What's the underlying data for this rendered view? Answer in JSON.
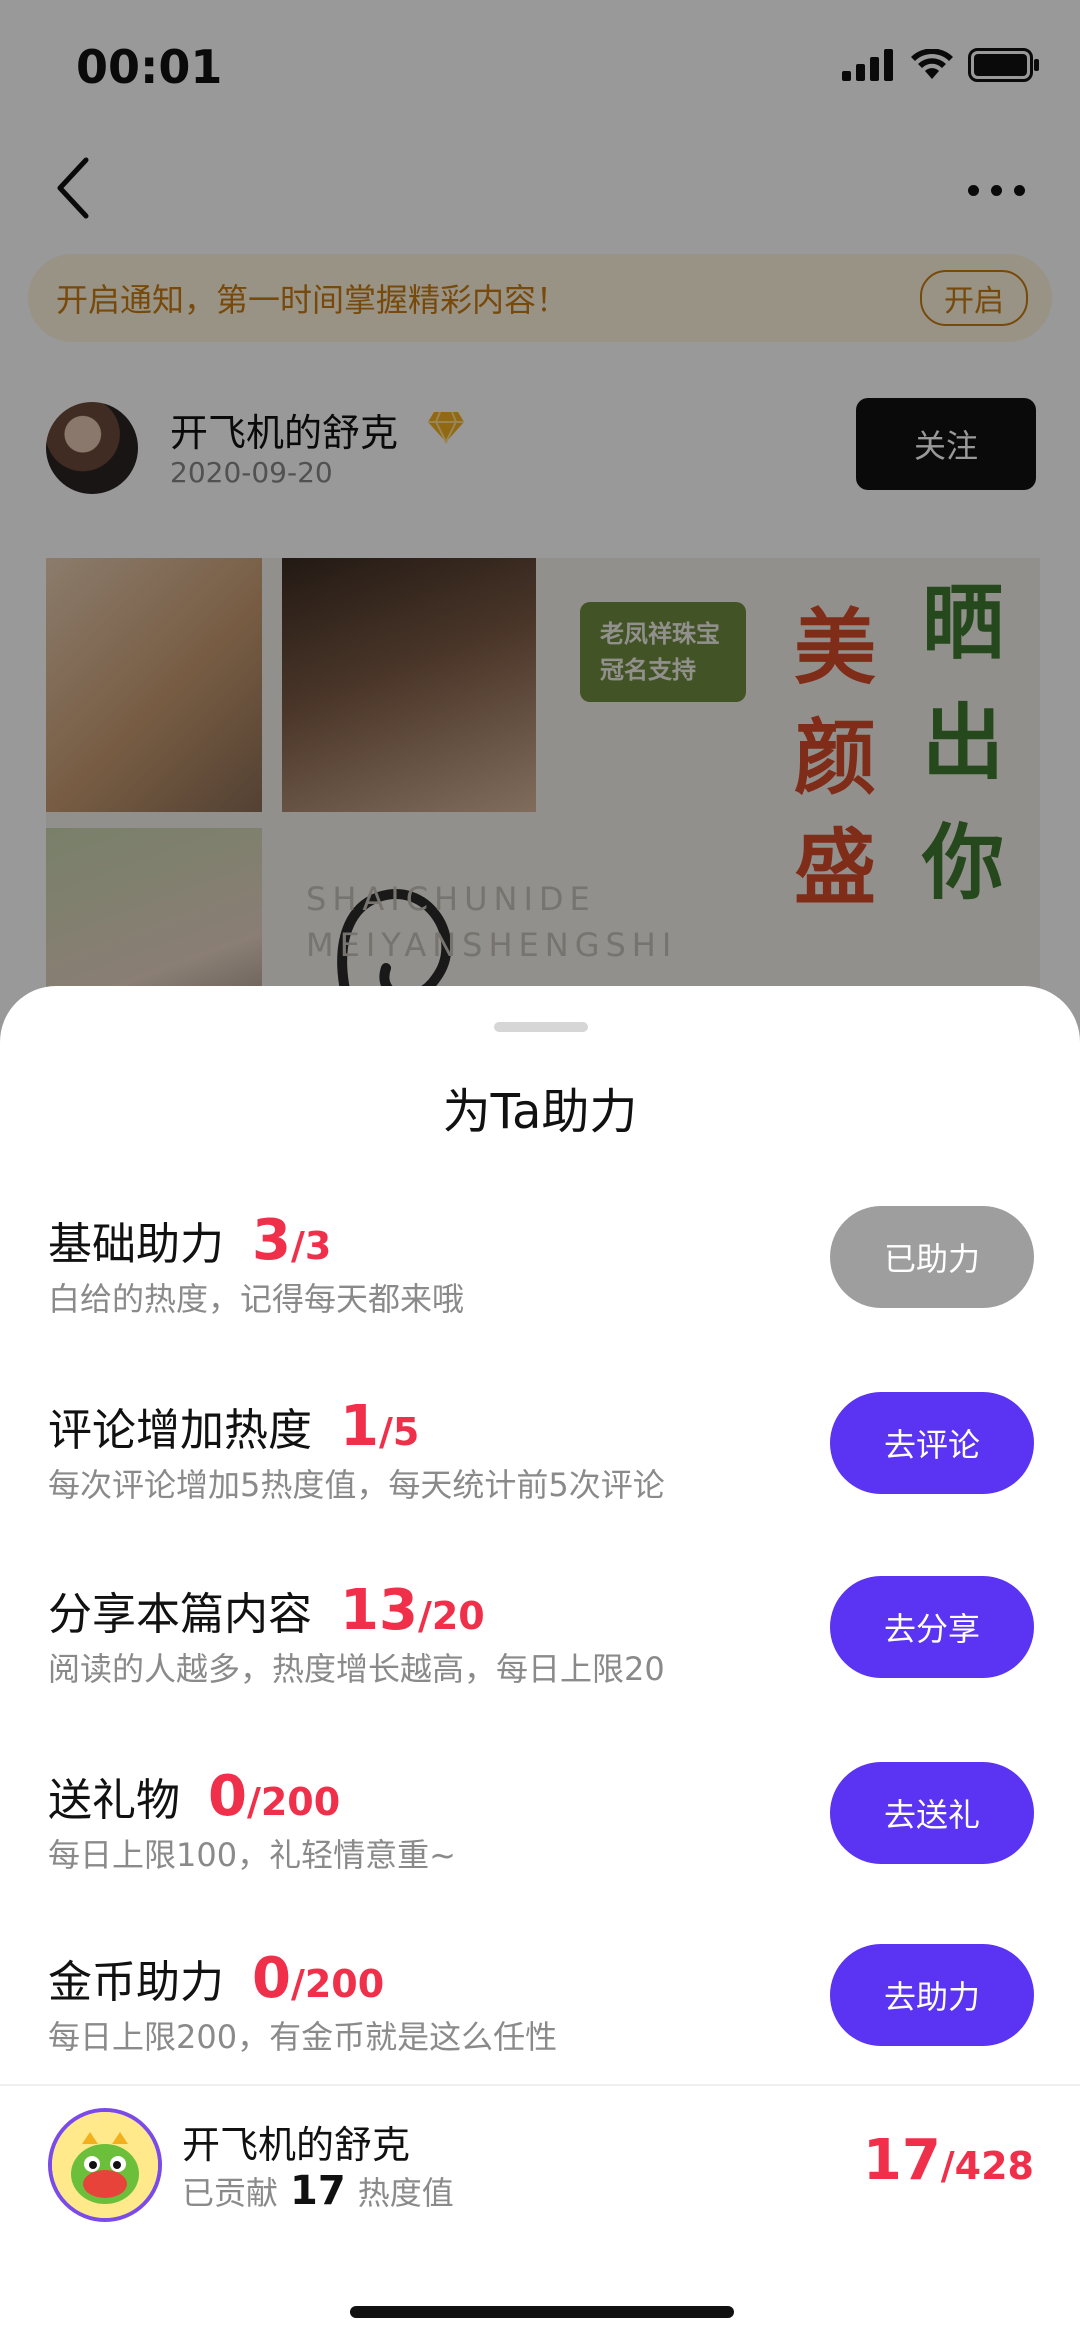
{
  "status_bar": {
    "time": "00:01"
  },
  "notice": {
    "text": "开启通知，第一时间掌握精彩内容！",
    "button": "开启"
  },
  "author": {
    "name": "开飞机的舒克",
    "date": "2020-09-20",
    "follow_label": "关注"
  },
  "banner": {
    "sponsor_line1": "老凤祥珠宝",
    "sponsor_line2": "冠名支持",
    "headline_red": "美颜盛",
    "headline_green": "晒出你",
    "watermark_line1": "SHAICHUNIDE",
    "watermark_line2": "MEIYANSHENGSHI"
  },
  "sheet": {
    "title": "为Ta助力",
    "tasks": [
      {
        "name": "基础助力",
        "current": "3",
        "total": "/3",
        "desc": "白给的热度，记得每天都来哦",
        "button": "已助力",
        "done": true
      },
      {
        "name": "评论增加热度",
        "current": "1",
        "total": "/5",
        "desc": "每次评论增加5热度值，每天统计前5次评论",
        "button": "去评论",
        "done": false
      },
      {
        "name": "分享本篇内容",
        "current": "13",
        "total": "/20",
        "desc": "阅读的人越多，热度增长越高，每日上限20",
        "button": "去分享",
        "done": false
      },
      {
        "name": "送礼物",
        "current": "0",
        "total": "/200",
        "desc": "每日上限100，礼轻情意重~",
        "button": "去送礼",
        "done": false
      },
      {
        "name": "金币助力",
        "current": "0",
        "total": "/200",
        "desc": "每日上限200，有金币就是这么任性",
        "button": "去助力",
        "done": false
      }
    ]
  },
  "footer": {
    "name": "开飞机的舒克",
    "contrib_prefix": "已贡献",
    "contrib_value": "17",
    "contrib_suffix": "热度值",
    "current": "17",
    "total": "/428"
  },
  "colors": {
    "accent": "#5b33f2",
    "count_red": "#f0304a",
    "done_gray": "#9e9e9e"
  }
}
